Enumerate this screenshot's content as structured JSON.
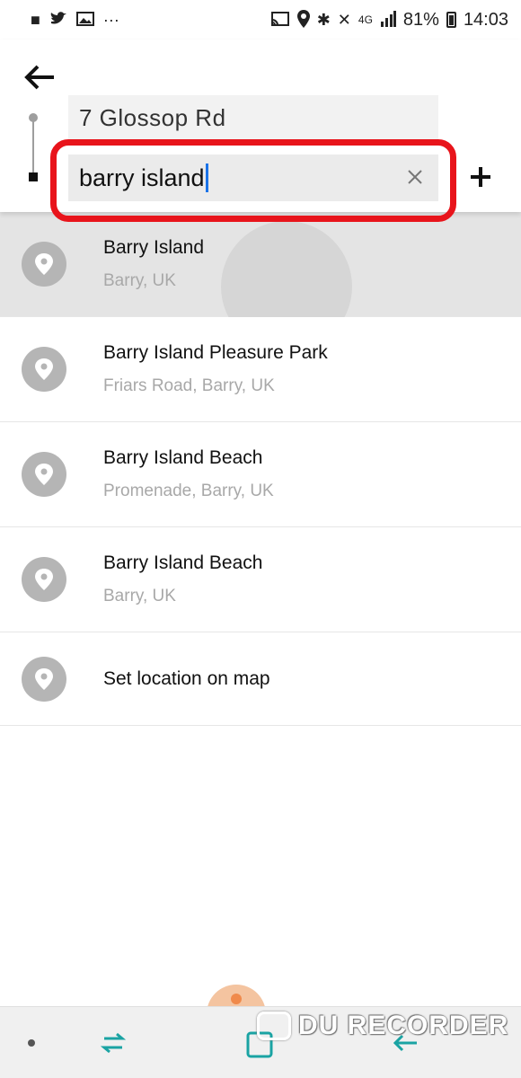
{
  "status_bar": {
    "battery_percent": "81%",
    "time": "14:03",
    "network": "4G",
    "left_icons": [
      "video-icon",
      "twitter-icon",
      "image-icon",
      "more-dots-icon"
    ],
    "right_icons": [
      "cast-icon",
      "location-icon",
      "bluetooth-icon",
      "mute-icon",
      "signal-icon",
      "battery-icon"
    ]
  },
  "header": {
    "pickup_value": "7 Glossop Rd",
    "destination_value": "barry island",
    "highlight_color": "#e8141b"
  },
  "results": [
    {
      "title": "Barry Island",
      "subtitle": "Barry, UK"
    },
    {
      "title": "Barry Island Pleasure Park",
      "subtitle": "Friars Road, Barry, UK"
    },
    {
      "title": "Barry Island Beach",
      "subtitle": "Promenade, Barry, UK"
    },
    {
      "title": "Barry Island Beach",
      "subtitle": "Barry, UK"
    },
    {
      "title": "Set location on map"
    }
  ],
  "watermark": {
    "text": "DU RECORDER"
  },
  "colors": {
    "accent_nav": "#1aa3a3",
    "pin_gray": "#b5b5b5",
    "selected_row": "#e4e4e4"
  }
}
